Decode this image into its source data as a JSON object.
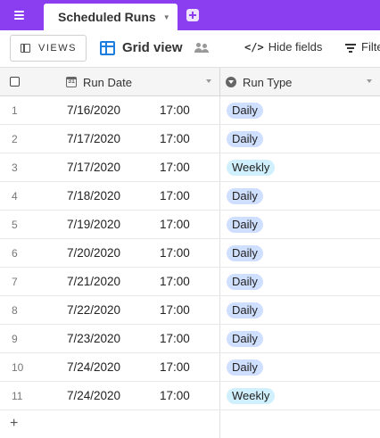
{
  "tabs": {
    "active_label": "Scheduled Runs"
  },
  "toolbar": {
    "views_label": "VIEWS",
    "view_name": "Grid view",
    "hide_fields_label": "Hide fields",
    "filter_label": "Filte"
  },
  "columns": {
    "col1": "Run Date",
    "col2": "Run Type"
  },
  "rows": [
    {
      "num": "1",
      "date": "7/16/2020",
      "time": "17:00",
      "type": "Daily"
    },
    {
      "num": "2",
      "date": "7/17/2020",
      "time": "17:00",
      "type": "Daily"
    },
    {
      "num": "3",
      "date": "7/17/2020",
      "time": "17:00",
      "type": "Weekly"
    },
    {
      "num": "4",
      "date": "7/18/2020",
      "time": "17:00",
      "type": "Daily"
    },
    {
      "num": "5",
      "date": "7/19/2020",
      "time": "17:00",
      "type": "Daily"
    },
    {
      "num": "6",
      "date": "7/20/2020",
      "time": "17:00",
      "type": "Daily"
    },
    {
      "num": "7",
      "date": "7/21/2020",
      "time": "17:00",
      "type": "Daily"
    },
    {
      "num": "8",
      "date": "7/22/2020",
      "time": "17:00",
      "type": "Daily"
    },
    {
      "num": "9",
      "date": "7/23/2020",
      "time": "17:00",
      "type": "Daily"
    },
    {
      "num": "10",
      "date": "7/24/2020",
      "time": "17:00",
      "type": "Daily"
    },
    {
      "num": "11",
      "date": "7/24/2020",
      "time": "17:00",
      "type": "Weekly"
    }
  ],
  "add_row_label": "+",
  "colors": {
    "brand": "#8a3ef0",
    "grid_view_icon": "#1c7fe0",
    "daily_pill": "#cfdfff",
    "weekly_pill": "#d0f0fd"
  },
  "icons": {
    "menu": "menu-icon",
    "add_tab": "add-tab-icon",
    "views": "sidebar-icon",
    "grid_view": "grid-view-icon",
    "collaborators": "people-icon",
    "hide_fields": "eye-off-icon",
    "filter": "filter-icon",
    "date_field": "calendar-icon",
    "select_field": "single-select-icon"
  }
}
